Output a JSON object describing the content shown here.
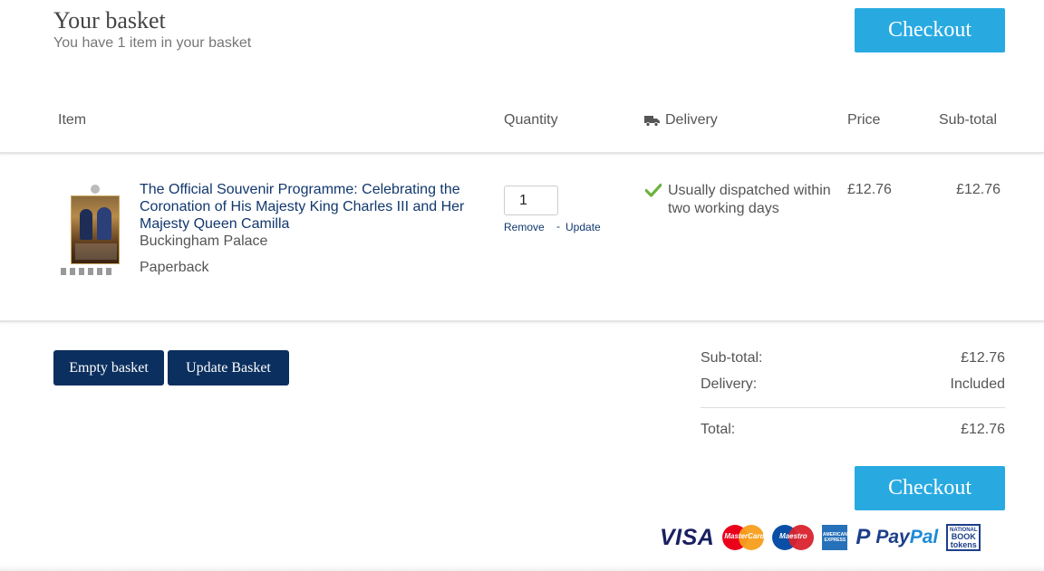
{
  "header": {
    "title": "Your basket",
    "subtitle": "You have 1 item in your basket",
    "checkout_label": "Checkout"
  },
  "columns": {
    "item": "Item",
    "quantity": "Quantity",
    "delivery": "Delivery",
    "price": "Price",
    "subtotal": "Sub-total"
  },
  "items": [
    {
      "title": "The Official Souvenir Programme: Celebrating the Coronation of His Majesty King Charles III and Her Majesty Queen Camilla",
      "author": "Buckingham Palace",
      "format": "Paperback",
      "quantity": "1",
      "remove_label": "Remove",
      "update_label": "Update",
      "dispatch": "Usually dispatched within two working days",
      "price": "£12.76",
      "subtotal": "£12.76"
    }
  ],
  "actions": {
    "empty_label": "Empty basket",
    "update_label": "Update Basket"
  },
  "summary": {
    "subtotal_label": "Sub-total:",
    "subtotal_value": "£12.76",
    "delivery_label": "Delivery:",
    "delivery_value": "Included",
    "total_label": "Total:",
    "total_value": "£12.76",
    "checkout_label": "Checkout"
  },
  "payments": {
    "visa": "VISA",
    "mastercard": "MasterCard",
    "maestro": "Maestro",
    "amex": "AMERICAN EXPRESS",
    "paypal_pay": "Pay",
    "paypal_pal": "Pal",
    "nbt_top": "NATIONAL",
    "nbt_mid": "BOOK",
    "nbt_bot": "tokens"
  },
  "colors": {
    "checkout": "#28aae1",
    "navy": "#0b2f5e",
    "link": "#12386e",
    "tick": "#6cb33f"
  }
}
